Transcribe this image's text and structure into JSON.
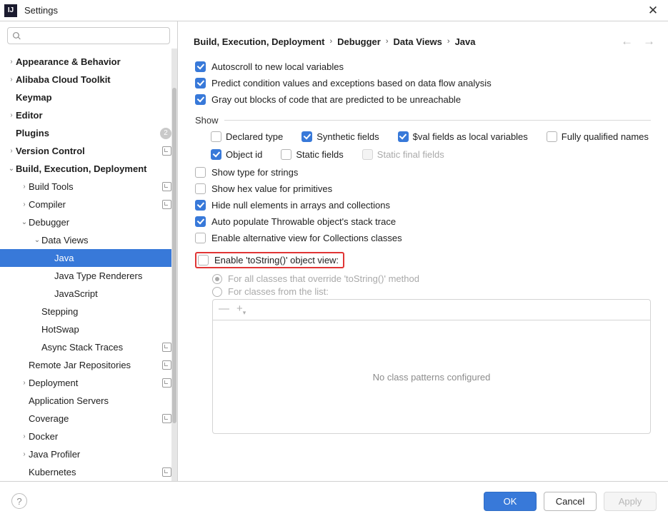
{
  "window": {
    "title": "Settings"
  },
  "search": {
    "placeholder": ""
  },
  "tree": [
    {
      "label": "Appearance & Behavior",
      "bold": true,
      "arrow": "right",
      "indent": 0
    },
    {
      "label": "Alibaba Cloud Toolkit",
      "bold": true,
      "arrow": "right",
      "indent": 0
    },
    {
      "label": "Keymap",
      "bold": true,
      "arrow": "none",
      "indent": 0
    },
    {
      "label": "Editor",
      "bold": true,
      "arrow": "right",
      "indent": 0
    },
    {
      "label": "Plugins",
      "bold": true,
      "arrow": "none",
      "indent": 0,
      "badge": "2"
    },
    {
      "label": "Version Control",
      "bold": true,
      "arrow": "right",
      "indent": 0,
      "proj": true
    },
    {
      "label": "Build, Execution, Deployment",
      "bold": true,
      "arrow": "down",
      "indent": 0
    },
    {
      "label": "Build Tools",
      "arrow": "right",
      "indent": 1,
      "proj": true
    },
    {
      "label": "Compiler",
      "arrow": "right",
      "indent": 1,
      "proj": true
    },
    {
      "label": "Debugger",
      "arrow": "down",
      "indent": 1
    },
    {
      "label": "Data Views",
      "arrow": "down",
      "indent": 2
    },
    {
      "label": "Java",
      "arrow": "none",
      "indent": 3,
      "selected": true
    },
    {
      "label": "Java Type Renderers",
      "arrow": "none",
      "indent": 3
    },
    {
      "label": "JavaScript",
      "arrow": "none",
      "indent": 3
    },
    {
      "label": "Stepping",
      "arrow": "none",
      "indent": 2
    },
    {
      "label": "HotSwap",
      "arrow": "none",
      "indent": 2
    },
    {
      "label": "Async Stack Traces",
      "arrow": "none",
      "indent": 2,
      "proj": true
    },
    {
      "label": "Remote Jar Repositories",
      "arrow": "none",
      "indent": 1,
      "proj": true
    },
    {
      "label": "Deployment",
      "arrow": "right",
      "indent": 1,
      "proj": true
    },
    {
      "label": "Application Servers",
      "arrow": "none",
      "indent": 1
    },
    {
      "label": "Coverage",
      "arrow": "none",
      "indent": 1,
      "proj": true
    },
    {
      "label": "Docker",
      "arrow": "right",
      "indent": 1
    },
    {
      "label": "Java Profiler",
      "arrow": "right",
      "indent": 1
    },
    {
      "label": "Kubernetes",
      "arrow": "none",
      "indent": 1,
      "proj": true
    }
  ],
  "breadcrumb": [
    "Build, Execution, Deployment",
    "Debugger",
    "Data Views",
    "Java"
  ],
  "opts_top": [
    {
      "label": "Autoscroll to new local variables",
      "checked": true
    },
    {
      "label": "Predict condition values and exceptions based on data flow analysis",
      "checked": true
    },
    {
      "label": "Gray out blocks of code that are predicted to be unreachable",
      "checked": true
    }
  ],
  "show_title": "Show",
  "show_line1": [
    {
      "label": "Declared type",
      "checked": false
    },
    {
      "label": "Synthetic fields",
      "checked": true
    },
    {
      "label": "$val fields as local variables",
      "checked": true
    },
    {
      "label": "Fully qualified names",
      "checked": false
    }
  ],
  "show_line2": [
    {
      "label": "Object id",
      "checked": true
    },
    {
      "label": "Static fields",
      "checked": false
    },
    {
      "label": "Static final fields",
      "checked": false,
      "disabled": true
    }
  ],
  "opts_mid": [
    {
      "label": "Show type for strings",
      "checked": false
    },
    {
      "label": "Show hex value for primitives",
      "checked": false
    },
    {
      "label": "Hide null elements in arrays and collections",
      "checked": true
    },
    {
      "label": "Auto populate Throwable object's stack trace",
      "checked": true
    },
    {
      "label": "Enable alternative view for Collections classes",
      "checked": false
    }
  ],
  "tostring": {
    "label": "Enable 'toString()' object view:",
    "r1": "For all classes that override 'toString()' method",
    "r2": "For classes from the list:"
  },
  "list_placeholder": "No class patterns configured",
  "buttons": {
    "ok": "OK",
    "cancel": "Cancel",
    "apply": "Apply"
  }
}
